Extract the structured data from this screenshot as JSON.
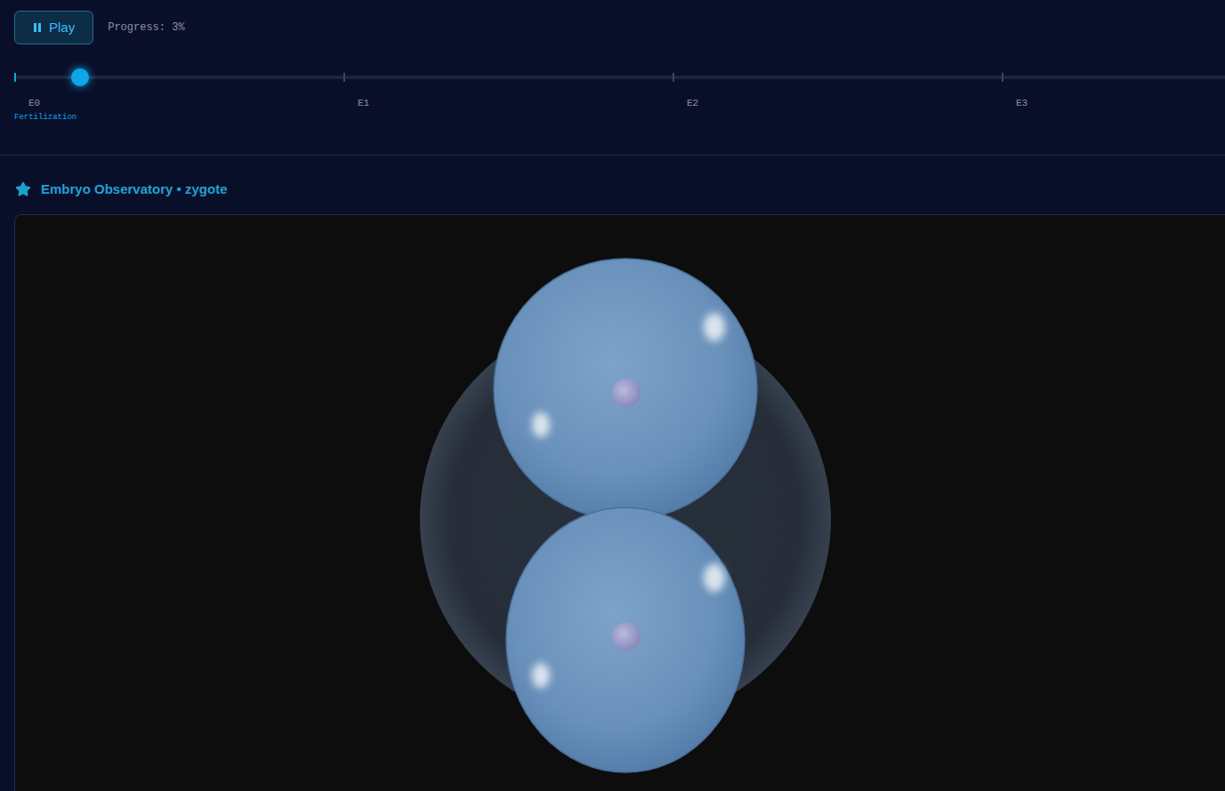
{
  "controls": {
    "play_button": {
      "label": "Play"
    },
    "progress": "Progress: 3%"
  },
  "timeline": {
    "level": 0.03,
    "ticks": [
      {
        "label": "E0",
        "caption": "Fertilization",
        "selected": true
      },
      {
        "label": "E1",
        "selected": false
      },
      {
        "label": "E2",
        "selected": false
      },
      {
        "label": "E3",
        "selected": false
      }
    ]
  },
  "panel": {
    "title": "Embryo Observatory • zygote"
  },
  "embryo": {
    "cells": 2
  }
}
